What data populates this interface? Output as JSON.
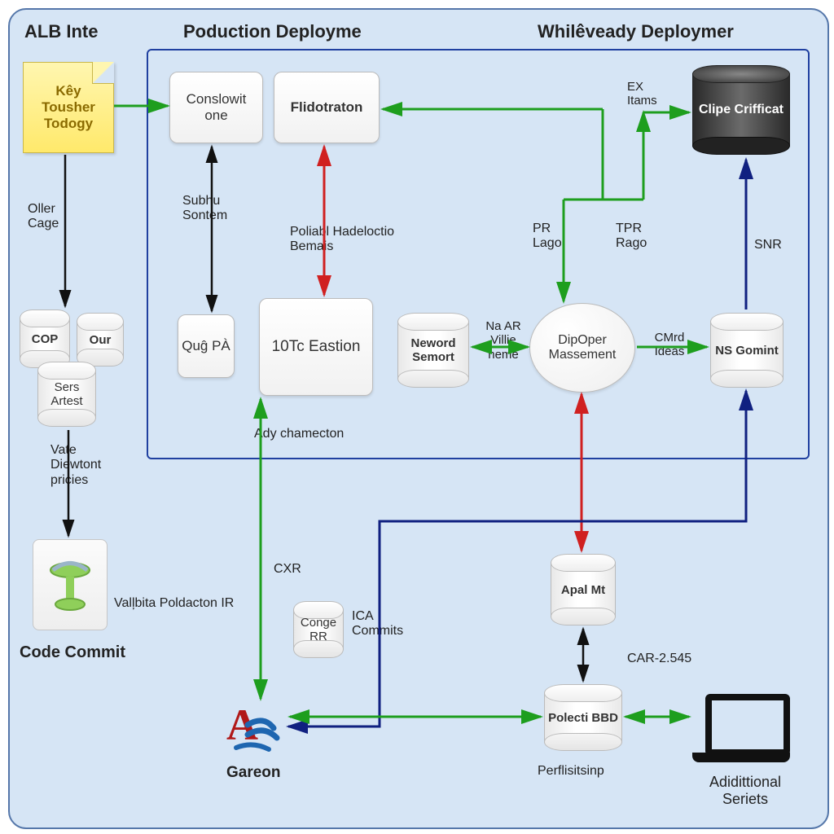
{
  "titles": {
    "alb": "ALB Inte",
    "production": "Poduction Deployme",
    "whileveady": "Whilêveady Deploymer"
  },
  "note": {
    "l1": "Kêy",
    "l2": "Tousher",
    "l3": "Todogy"
  },
  "boxes": {
    "conslowit": "Conslowit one",
    "flidotration": "Flidotraton",
    "qug": "Quĝ PÀ",
    "eastion": "10Tc Eastion"
  },
  "circle": {
    "dipoper": "DipOper Massement"
  },
  "cylinders": {
    "cop": "COP",
    "our": "Our",
    "sets": "Sers Artest",
    "neword": "Neword Semort",
    "ns": "NS Gomint",
    "clipe": "Clipe Crifficat",
    "conge": "Conge RR",
    "apal": "Apal Mt",
    "polecti": "Polecti BBD"
  },
  "labels": {
    "oller": "Oller Cage",
    "subhu": "Subhu Sontem",
    "poliabl": "Poliabl Hadeloctio Bemais",
    "pr": "PR Lago",
    "tpr": "TPR Rago",
    "ex": "EX Itams",
    "snr": "SNR",
    "na": "Na AR Villie heme",
    "cmd": "CMrd Ideas",
    "ady": "Ady chamecton",
    "vate": "Vate Diewtont pricies",
    "cxr": "CXR",
    "ica": "ICA Commits",
    "valpol": "Valļbita Poldacton IR",
    "car": "CAR-2.545",
    "perf": "Perflisitsinp",
    "codecommit": "Code Commit",
    "gareon": "Gareon",
    "additional": "Adidittional Seriets"
  }
}
